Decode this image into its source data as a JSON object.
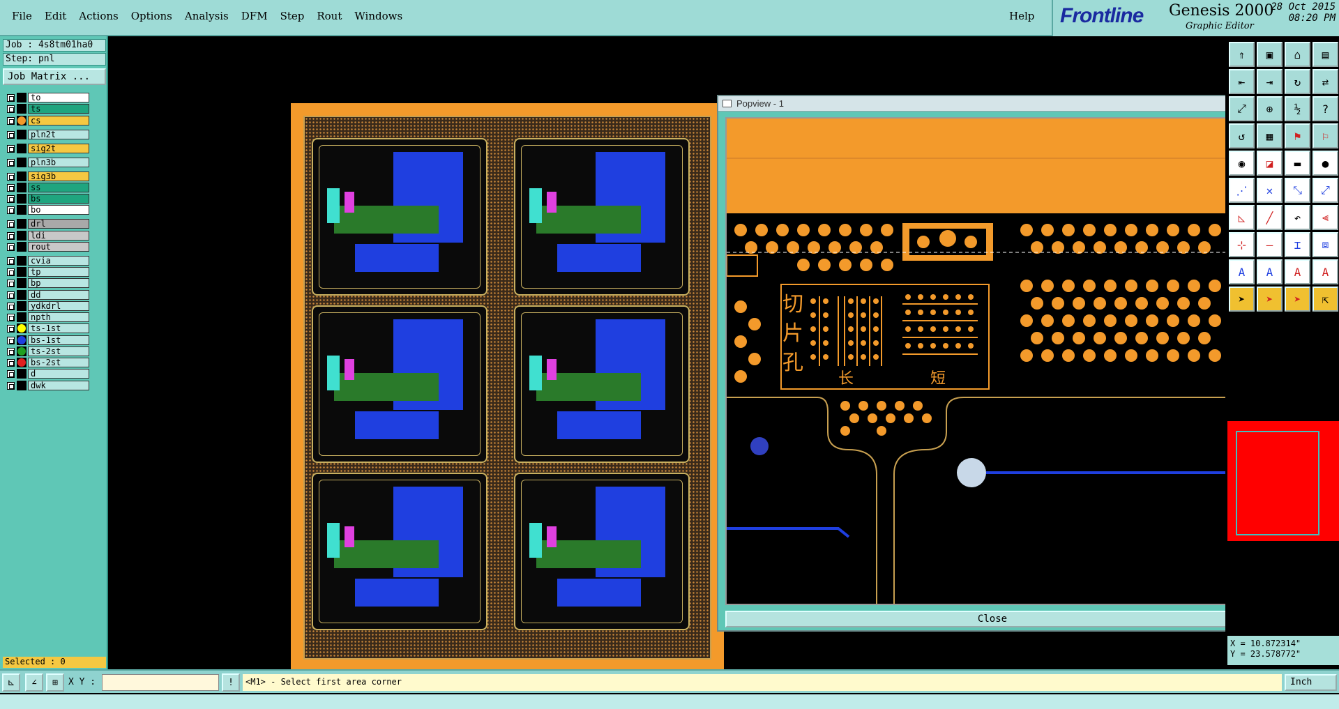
{
  "menubar": {
    "items": [
      "File",
      "Edit",
      "Actions",
      "Options",
      "Analysis",
      "DFM",
      "Step",
      "Rout",
      "Windows"
    ],
    "help": "Help"
  },
  "brand": {
    "logo": "Frontline",
    "product": "Genesis 2000",
    "subtitle": "Graphic Editor",
    "date": "28 Oct 2015",
    "time": "08:20 PM"
  },
  "job": {
    "job_label": "Job : 4s8tm01ha0",
    "step_label": "Step: pnl",
    "matrix_button": "Job Matrix ..."
  },
  "layers": [
    {
      "name": "to",
      "bg": "#ffffff",
      "swatch": "#000000"
    },
    {
      "name": "ts",
      "bg": "#1fa57f",
      "swatch": "#000000"
    },
    {
      "name": "cs",
      "bg": "#f5c842",
      "swatch": "#f39a2b"
    },
    {
      "name": "pln2t",
      "bg": "#b8e6e2",
      "swatch": "#000000"
    },
    {
      "name": "sig2t",
      "bg": "#f5c842",
      "swatch": "#000000"
    },
    {
      "name": "pln3b",
      "bg": "#b8e6e2",
      "swatch": "#000000"
    },
    {
      "name": "sig3b",
      "bg": "#f5c842",
      "swatch": "#000000"
    },
    {
      "name": "ss",
      "bg": "#1fa57f",
      "swatch": "#000000"
    },
    {
      "name": "bs",
      "bg": "#1fa57f",
      "swatch": "#000000"
    },
    {
      "name": "bo",
      "bg": "#ffffff",
      "swatch": "#000000"
    },
    {
      "name": "drl",
      "bg": "#a9a9a9",
      "swatch": "#000000"
    },
    {
      "name": "ldi",
      "bg": "#c8c8c8",
      "swatch": "#000000"
    },
    {
      "name": "rout",
      "bg": "#c8c8c8",
      "swatch": "#000000"
    },
    {
      "name": "cvia",
      "bg": "#b8e6e2",
      "swatch": "#000000"
    },
    {
      "name": "tp",
      "bg": "#b8e6e2",
      "swatch": "#000000"
    },
    {
      "name": "bp",
      "bg": "#b8e6e2",
      "swatch": "#000000"
    },
    {
      "name": "dd",
      "bg": "#b8e6e2",
      "swatch": "#000000"
    },
    {
      "name": "ydkdrl",
      "bg": "#b8e6e2",
      "swatch": "#000000"
    },
    {
      "name": "npth",
      "bg": "#b8e6e2",
      "swatch": "#000000"
    },
    {
      "name": "ts-1st",
      "bg": "#b8e6e2",
      "swatch": "#ffff00"
    },
    {
      "name": "bs-1st",
      "bg": "#b8e6e2",
      "swatch": "#1f3fe0"
    },
    {
      "name": "ts-2st",
      "bg": "#b8e6e2",
      "swatch": "#20a020"
    },
    {
      "name": "bs-2st",
      "bg": "#b8e6e2",
      "swatch": "#e02020"
    },
    {
      "name": "d",
      "bg": "#b8e6e2",
      "swatch": "#000000"
    },
    {
      "name": "dwk",
      "bg": "#b8e6e2",
      "swatch": "#000000"
    }
  ],
  "selected": "Selected : 0",
  "popview": {
    "title": "Popview - 1",
    "close_label": "Close",
    "cjk_vertical": [
      "切",
      "片",
      "孔"
    ],
    "cjk_long": "长",
    "cjk_short": "短"
  },
  "coords": {
    "x": "X = 10.872314\"",
    "y": "Y = 23.578772\""
  },
  "status": {
    "xy_label": "X Y :",
    "prompt": "<M1> - Select first area corner",
    "unit": "Inch"
  }
}
